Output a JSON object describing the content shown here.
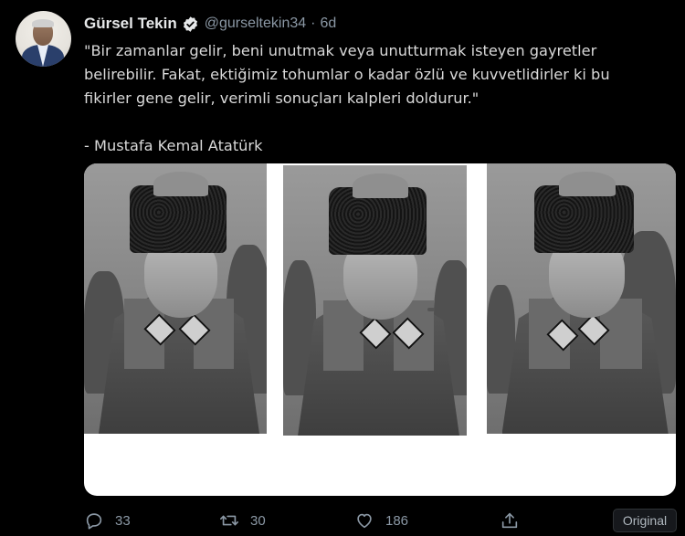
{
  "tweet": {
    "author_name": "Gürsel Tekin",
    "handle": "@gurseltekin34",
    "separator": "·",
    "time": "6d",
    "text": "\"Bir zamanlar gelir, beni unutmak veya unutturmak isteyen gayretler\nbelirebilir. Fakat, ektiğimiz tohumlar o kadar özlü ve kuvvetlidirler ki bu\nfikirler gene gelir, verimli sonuçları kalpleri doldurur.\"\n\n- Mustafa Kemal Atatürk",
    "verified_icon": "verified-badge-icon"
  },
  "actions": {
    "reply_count": "33",
    "retweet_count": "30",
    "like_count": "186",
    "original_label": "Original"
  },
  "colors": {
    "background": "#000000",
    "text": "#d9d9d9",
    "muted": "#8b98a5"
  }
}
